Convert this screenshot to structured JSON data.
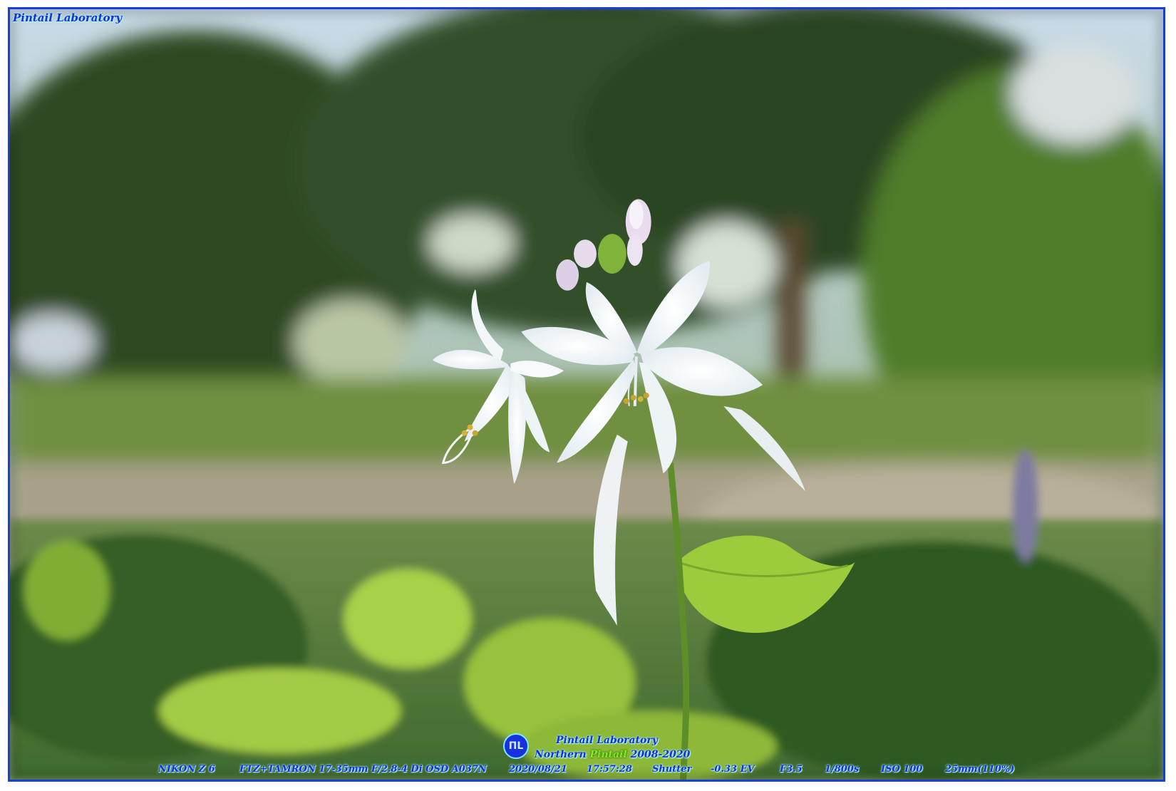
{
  "watermark_top": "Pintail Laboratory",
  "logo": {
    "badge": "ΠL",
    "line1": "Pintail Laboratory",
    "line2_prefix": "Northern ",
    "line2_emphasis": "Pintail",
    "line2_suffix": " 2008-2020"
  },
  "exif": {
    "camera": "NIKON Z 6",
    "lens": "FTZ+TAMRON 17-35mm F/2.8-4 Di OSD A037N",
    "date": "2020/08/21",
    "time": "17:57:28",
    "mode": "Shutter",
    "ev": "-0.33 EV",
    "aperture": "F3.5",
    "shutter": "1/800s",
    "iso": "ISO 100",
    "focal": "25mm(110%)"
  },
  "colors": {
    "frame_border": "#1a3fd6",
    "text": "#1a2ed8",
    "glow": "#7be8ff"
  },
  "subject": "white-hosta-flower-icon"
}
